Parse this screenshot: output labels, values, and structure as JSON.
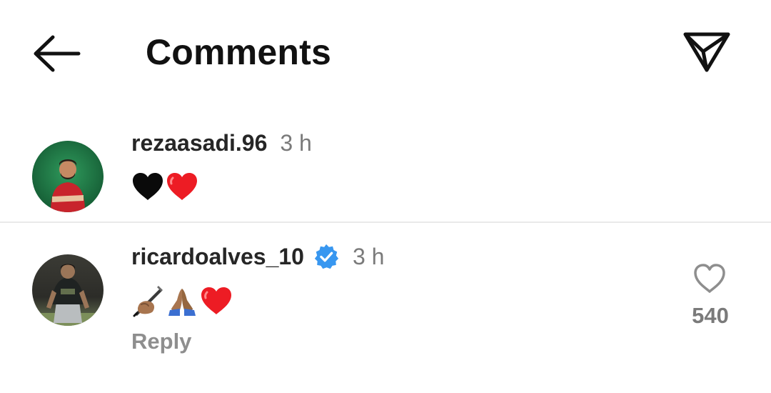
{
  "header": {
    "title": "Comments",
    "back_icon": "arrow-left-icon",
    "send_icon": "paper-plane-icon"
  },
  "comments": [
    {
      "username": "rezaasadi.96",
      "time": "3 h",
      "text_emojis": [
        "black-heart-emoji",
        "red-heart-emoji"
      ],
      "verified": false
    },
    {
      "username": "ricardoalves_10",
      "time": "3 h",
      "verified": true,
      "text_emojis": [
        "writing-hand-emoji",
        "folded-hands-emoji",
        "red-heart-emoji"
      ],
      "reply_label": "Reply",
      "like_count": "540"
    }
  ],
  "colors": {
    "verified_blue": "#3897f0",
    "heart_red": "#ed1c24",
    "muted_text": "#8e8e8e"
  }
}
